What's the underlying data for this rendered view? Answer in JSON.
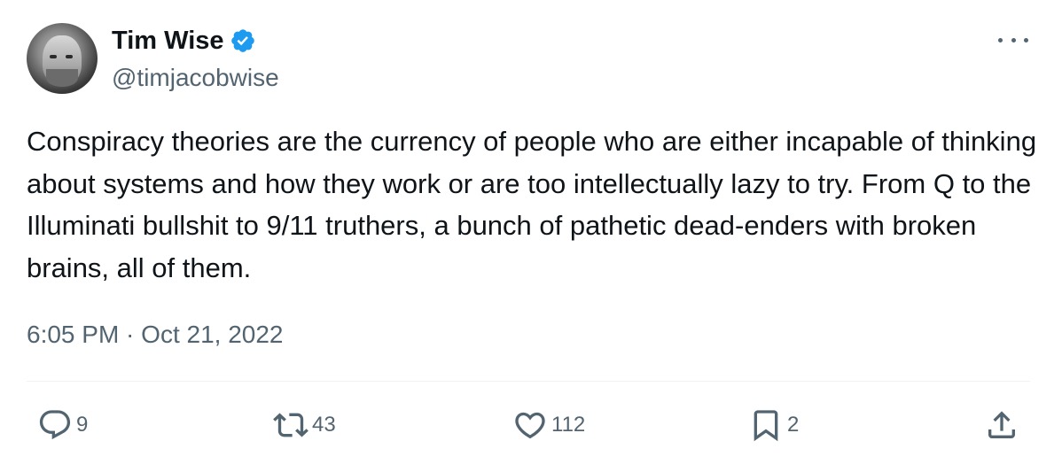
{
  "author": {
    "display_name": "Tim Wise",
    "handle": "@timjacobwise",
    "verified": true
  },
  "tweet": {
    "text": "Conspiracy theories are the currency of people who are either incapable of thinking about systems and how they work or are too intellectually lazy to try. From Q to the Illuminati bullshit to 9/11 truthers, a bunch of pathetic dead-enders with broken brains, all of them.",
    "timestamp": "6:05 PM · Oct 21, 2022"
  },
  "actions": {
    "reply_count": "9",
    "retweet_count": "43",
    "like_count": "112",
    "bookmark_count": "2"
  },
  "icons": {
    "reply": "reply-icon",
    "retweet": "retweet-icon",
    "like": "heart-icon",
    "bookmark": "bookmark-icon",
    "share": "share-icon",
    "more": "more-icon",
    "verified": "verified-badge-icon"
  },
  "colors": {
    "text": "#0f1419",
    "secondary": "#536471",
    "verified": "#1d9bf0",
    "divider": "#eff3f4"
  }
}
